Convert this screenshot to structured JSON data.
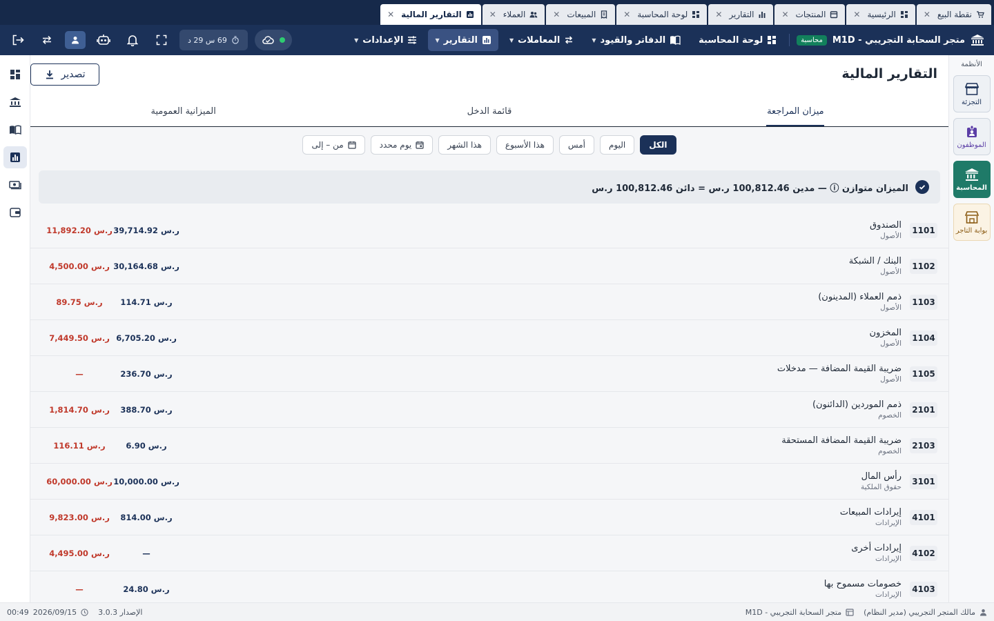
{
  "tabs": [
    {
      "label": "نقطة البيع",
      "icon": "cart-icon",
      "active": false
    },
    {
      "label": "الرئيسية",
      "icon": "dashboard-icon",
      "active": false
    },
    {
      "label": "المنتجات",
      "icon": "box-icon",
      "active": false
    },
    {
      "label": "التقارير",
      "icon": "bar-chart-icon",
      "active": false
    },
    {
      "label": "لوحة المحاسبة",
      "icon": "dashboard-icon",
      "active": false
    },
    {
      "label": "المبيعات",
      "icon": "receipt-icon",
      "active": false
    },
    {
      "label": "العملاء",
      "icon": "users-icon",
      "active": false
    },
    {
      "label": "التقارير المالية",
      "icon": "report-icon",
      "active": true
    }
  ],
  "header": {
    "brand_name": "متجر السحابة التجريبي - M1D",
    "brand_badge": "محاسبة",
    "nav": [
      {
        "label": "لوحة المحاسبة",
        "icon": "dashboard-icon",
        "has_caret": false,
        "active": false
      },
      {
        "label": "الدفاتر والقيود",
        "icon": "book-icon",
        "has_caret": true,
        "active": false
      },
      {
        "label": "المعاملات",
        "icon": "swap-icon",
        "has_caret": true,
        "active": false
      },
      {
        "label": "التقارير",
        "icon": "bar-chart-icon",
        "has_caret": true,
        "active": true
      },
      {
        "label": "الإعدادات",
        "icon": "sliders-icon",
        "has_caret": true,
        "active": false
      }
    ],
    "timer": "69 س 29 د"
  },
  "rail": {
    "title": "الأنظمة",
    "items": [
      {
        "label": "التجزئة",
        "icon": "store-icon"
      },
      {
        "label": "الموظفون",
        "icon": "id-badge-icon"
      },
      {
        "label": "المحاسبة",
        "icon": "bank-icon"
      },
      {
        "label": "بوابة التاجر",
        "icon": "shop-icon"
      }
    ]
  },
  "page": {
    "title": "التقارير المالية",
    "export_label": "تصدير",
    "subtabs": [
      "ميزان المراجعة",
      "قائمة الدخل",
      "الميزانية العمومية"
    ],
    "filters": [
      "الكل",
      "اليوم",
      "أمس",
      "هذا الأسبوع",
      "هذا الشهر",
      "يوم محدد",
      "من – إلى"
    ],
    "balance_text": "الميزان متوازن ⓘ — مدين 100,812.46 ر.س = دائن 100,812.46 ر.س"
  },
  "accounts": [
    {
      "code": "1101",
      "name": "الصندوق",
      "category": "الأصول",
      "debit": "39,714.92 ر.س",
      "credit": "11,892.20 ر.س"
    },
    {
      "code": "1102",
      "name": "البنك / الشبكة",
      "category": "الأصول",
      "debit": "30,164.68 ر.س",
      "credit": "4,500.00 ر.س"
    },
    {
      "code": "1103",
      "name": "ذمم العملاء (المدينون)",
      "category": "الأصول",
      "debit": "114.71 ر.س",
      "credit": "89.75 ر.س"
    },
    {
      "code": "1104",
      "name": "المخزون",
      "category": "الأصول",
      "debit": "6,705.20 ر.س",
      "credit": "7,449.50 ر.س"
    },
    {
      "code": "1105",
      "name": "ضريبة القيمة المضافة — مدخلات",
      "category": "الأصول",
      "debit": "236.70 ر.س",
      "credit": "—"
    },
    {
      "code": "2101",
      "name": "ذمم الموردين (الدائنون)",
      "category": "الخصوم",
      "debit": "388.70 ر.س",
      "credit": "1,814.70 ر.س"
    },
    {
      "code": "2103",
      "name": "ضريبة القيمة المضافة المستحقة",
      "category": "الخصوم",
      "debit": "6.90 ر.س",
      "credit": "116.11 ر.س"
    },
    {
      "code": "3101",
      "name": "رأس المال",
      "category": "حقوق الملكية",
      "debit": "10,000.00 ر.س",
      "credit": "60,000.00 ر.س"
    },
    {
      "code": "4101",
      "name": "إيرادات المبيعات",
      "category": "الإيرادات",
      "debit": "814.00 ر.س",
      "credit": "9,823.00 ر.س"
    },
    {
      "code": "4102",
      "name": "إيرادات أخرى",
      "category": "الإيرادات",
      "debit": "—",
      "credit": "4,495.00 ر.س"
    },
    {
      "code": "4103",
      "name": "خصومات مسموح بها",
      "category": "الإيرادات",
      "debit": "24.80 ر.س",
      "credit": "—"
    }
  ],
  "status": {
    "user": "مالك المتجر التجريبي (مدير النظام)",
    "store": "متجر السحابة التجريبي - M1D",
    "version": "الإصدار 3.0.3",
    "date": "2026/09/15",
    "time": "00:49"
  }
}
